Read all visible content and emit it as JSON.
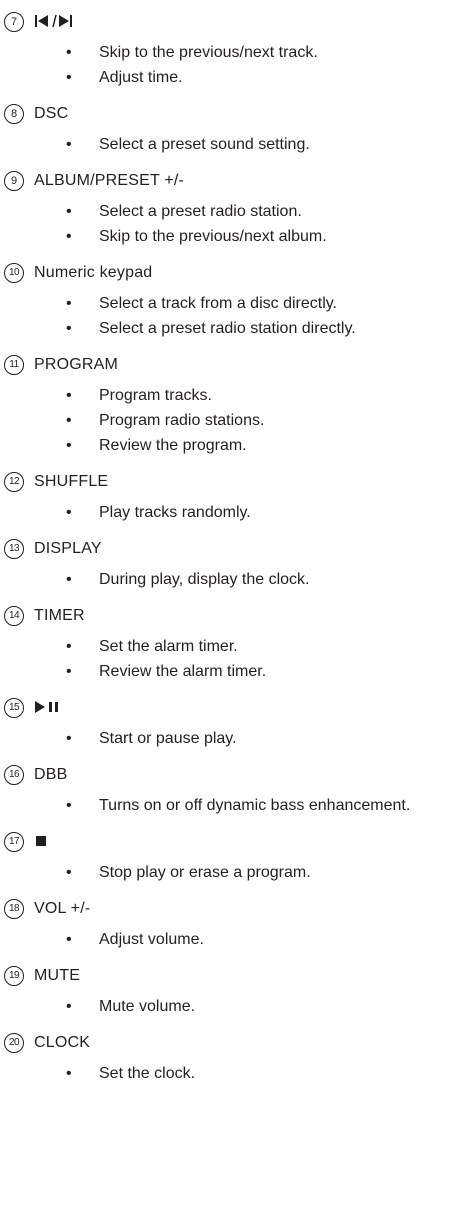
{
  "items": [
    {
      "num": "7",
      "label": "",
      "icon": "prev-next-icon",
      "bullets": [
        "Skip to the previous/next track.",
        "Adjust time."
      ]
    },
    {
      "num": "8",
      "label": "DSC",
      "icon": "",
      "bullets": [
        "Select a preset sound setting."
      ]
    },
    {
      "num": "9",
      "label": "ALBUM/PRESET +/-",
      "icon": "",
      "bullets": [
        "Select a preset radio station.",
        "Skip to the previous/next album."
      ]
    },
    {
      "num": "10",
      "label": "Numeric keypad",
      "icon": "",
      "bullets": [
        "Select a track from a disc directly.",
        "Select a preset radio station directly."
      ]
    },
    {
      "num": "11",
      "label": "PROGRAM",
      "icon": "",
      "bullets": [
        "Program tracks.",
        "Program radio stations.",
        "Review the program."
      ]
    },
    {
      "num": "12",
      "label": "SHUFFLE",
      "icon": "",
      "bullets": [
        "Play tracks randomly."
      ]
    },
    {
      "num": "13",
      "label": "DISPLAY",
      "icon": "",
      "bullets": [
        "During play, display the clock."
      ]
    },
    {
      "num": "14",
      "label": "TIMER",
      "icon": "",
      "bullets": [
        "Set the alarm timer.",
        "Review the alarm timer."
      ]
    },
    {
      "num": "15",
      "label": "",
      "icon": "play-pause-icon",
      "bullets": [
        "Start or pause play."
      ]
    },
    {
      "num": "16",
      "label": "DBB",
      "icon": "",
      "bullets": [
        "Turns on or off dynamic bass enhancement."
      ]
    },
    {
      "num": "17",
      "label": "",
      "icon": "stop-icon",
      "bullets": [
        "Stop play or erase a program."
      ]
    },
    {
      "num": "18",
      "label": "VOL +/-",
      "icon": "",
      "bullets": [
        "Adjust volume."
      ]
    },
    {
      "num": "19",
      "label": "MUTE",
      "icon": "",
      "bullets": [
        "Mute volume."
      ]
    },
    {
      "num": "20",
      "label": "CLOCK",
      "icon": "",
      "bullets": [
        "Set the clock."
      ]
    }
  ],
  "bullet_char": "•"
}
